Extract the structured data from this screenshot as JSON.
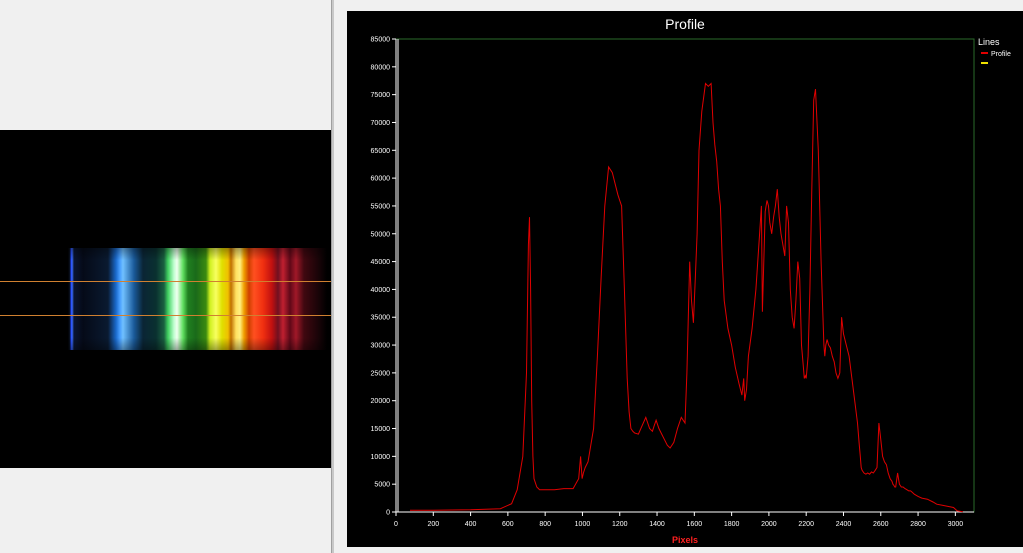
{
  "app": {
    "spectrum_panel": {
      "roi_line_color": "#d08030"
    }
  },
  "chart_data": {
    "type": "line",
    "title": "Profile",
    "xlabel": "Pixels",
    "ylabel": "",
    "xlim": [
      0,
      3100
    ],
    "ylim": [
      0,
      85000
    ],
    "x_ticks": [
      0,
      200,
      400,
      600,
      800,
      1000,
      1200,
      1400,
      1600,
      1800,
      2000,
      2200,
      2400,
      2600,
      2800,
      3000
    ],
    "y_ticks": [
      0,
      5000,
      10000,
      15000,
      20000,
      25000,
      30000,
      35000,
      40000,
      45000,
      50000,
      55000,
      60000,
      65000,
      70000,
      75000,
      80000,
      85000
    ],
    "legend": {
      "title": "Lines",
      "position": "right",
      "entries": [
        {
          "label": "Profile",
          "color": "#e00000"
        },
        {
          "label": "",
          "color": "#f0e000"
        }
      ]
    },
    "colors": {
      "background": "#000000",
      "plot_border": "#2a6a2a",
      "axis": "#ffffff",
      "text": "#ffffff",
      "xlabel": "#ff2020",
      "series": "#e00000"
    },
    "series": [
      {
        "name": "Profile",
        "x": [
          75,
          200,
          400,
          560,
          620,
          650,
          680,
          700,
          710,
          716,
          722,
          728,
          734,
          740,
          755,
          770,
          800,
          850,
          900,
          950,
          980,
          990,
          998,
          1005,
          1015,
          1030,
          1060,
          1080,
          1100,
          1120,
          1140,
          1160,
          1175,
          1190,
          1200,
          1210,
          1225,
          1240,
          1250,
          1260,
          1270,
          1280,
          1300,
          1320,
          1340,
          1360,
          1375,
          1385,
          1395,
          1410,
          1425,
          1440,
          1455,
          1470,
          1490,
          1510,
          1530,
          1550,
          1560,
          1575,
          1585,
          1595,
          1605,
          1615,
          1625,
          1640,
          1660,
          1675,
          1690,
          1700,
          1710,
          1720,
          1730,
          1740,
          1750,
          1760,
          1780,
          1800,
          1820,
          1840,
          1855,
          1865,
          1870,
          1880,
          1890,
          1910,
          1930,
          1950,
          1960,
          1965,
          1980,
          1990,
          1998,
          2005,
          2015,
          2025,
          2035,
          2045,
          2055,
          2065,
          2075,
          2085,
          2095,
          2105,
          2115,
          2125,
          2135,
          2145,
          2155,
          2165,
          2175,
          2185,
          2190,
          2195,
          2200,
          2210,
          2220,
          2230,
          2240,
          2250,
          2265,
          2280,
          2295,
          2300,
          2305,
          2312,
          2320,
          2330,
          2340,
          2350,
          2360,
          2370,
          2380,
          2390,
          2400,
          2415,
          2430,
          2445,
          2460,
          2475,
          2485,
          2490,
          2495,
          2500,
          2510,
          2520,
          2530,
          2540,
          2550,
          2560,
          2570,
          2580,
          2590,
          2600,
          2610,
          2620,
          2630,
          2640,
          2650,
          2660,
          2665,
          2670,
          2675,
          2680,
          2690,
          2700,
          2710,
          2720,
          2730,
          2740,
          2750,
          2760,
          2770,
          2780,
          2790,
          2800,
          2820,
          2850,
          2880,
          2900,
          2930,
          2960,
          2990,
          3010,
          3040
        ],
        "y": [
          300,
          300,
          400,
          600,
          1500,
          4000,
          10000,
          25000,
          48000,
          53000,
          40000,
          20000,
          10000,
          6000,
          4500,
          4000,
          4000,
          4000,
          4200,
          4200,
          6000,
          10000,
          6000,
          7000,
          8000,
          9000,
          15000,
          28000,
          42000,
          55000,
          62000,
          61000,
          59000,
          57000,
          56000,
          55000,
          40000,
          24000,
          18000,
          15000,
          14500,
          14200,
          14000,
          15500,
          17000,
          15000,
          14500,
          15500,
          16500,
          15000,
          14000,
          13000,
          12000,
          11500,
          12500,
          15000,
          17000,
          16000,
          25000,
          45000,
          38000,
          34000,
          42000,
          50000,
          65000,
          72000,
          77000,
          76500,
          77000,
          70000,
          66000,
          63000,
          58000,
          55000,
          45000,
          38000,
          33000,
          30000,
          26000,
          23000,
          21000,
          24000,
          20000,
          22000,
          28000,
          33000,
          40000,
          50000,
          55000,
          36000,
          54000,
          56000,
          55000,
          52000,
          50000,
          53000,
          55000,
          58000,
          53000,
          50000,
          48000,
          46000,
          55000,
          52000,
          40000,
          35000,
          33000,
          38000,
          45000,
          42000,
          30000,
          26000,
          24000,
          24500,
          24000,
          28000,
          40000,
          58000,
          74000,
          76000,
          65000,
          45000,
          30000,
          28000,
          30000,
          31000,
          30000,
          29500,
          28000,
          27000,
          25000,
          24000,
          25000,
          35000,
          32000,
          30000,
          28000,
          24000,
          20000,
          16000,
          12000,
          10000,
          8000,
          7500,
          7000,
          6800,
          7000,
          6800,
          7200,
          7000,
          7500,
          8000,
          16000,
          13000,
          10000,
          9000,
          8500,
          7000,
          6000,
          5500,
          5000,
          4800,
          4500,
          4500,
          7000,
          5000,
          4500,
          4500,
          4200,
          4000,
          3800,
          3800,
          3500,
          3200,
          3000,
          2800,
          2500,
          2300,
          1800,
          1400,
          1200,
          1000,
          800,
          200,
          50
        ]
      }
    ]
  }
}
